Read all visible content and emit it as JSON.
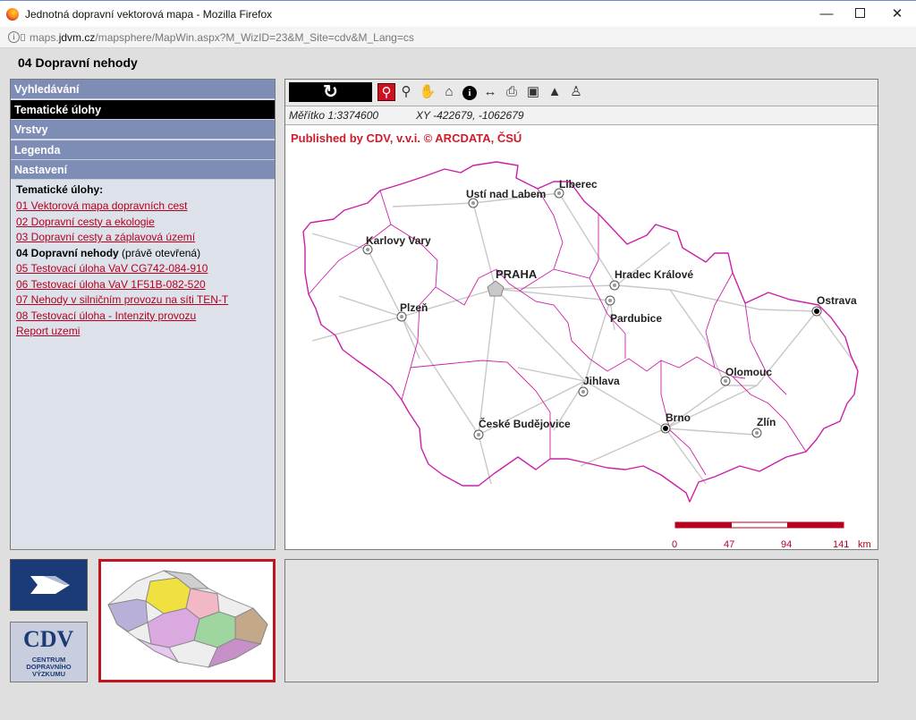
{
  "browser": {
    "window_title": "Jednotná dopravní vektorová mapa - Mozilla Firefox",
    "url_prefix": "maps.",
    "url_host": "jdvm.cz",
    "url_path": "/mapsphere/MapWin.aspx?M_WizID=23&M_Site=cdv&M_Lang=cs",
    "icons": [
      "firefox-icon",
      "info-icon",
      "lock-icon"
    ]
  },
  "page": {
    "title": "04 Dopravní nehody"
  },
  "sidebar": {
    "tabs": [
      {
        "label": "Vyhledávání",
        "active": false
      },
      {
        "label": "Tematické úlohy",
        "active": true
      },
      {
        "label": "Vrstvy",
        "active": false
      },
      {
        "label": "Legenda",
        "active": false
      },
      {
        "label": "Nastavení",
        "active": false
      }
    ],
    "heading": "Tematické úlohy:",
    "tasks": [
      {
        "label": "01 Vektorová mapa dopravních cest"
      },
      {
        "label": "02 Dopravní cesty a ekologie"
      },
      {
        "label": "03 Dopravní cesty a záplavová území"
      },
      {
        "label": "04 Dopravní nehody",
        "suffix": " (právě otevřená)"
      },
      {
        "label": "05 Testovací úloha VaV CG742-084-910"
      },
      {
        "label": "06 Testovací úloha VaV 1F51B-082-520"
      },
      {
        "label": "07 Nehody v silničním provozu na síti TEN-T"
      },
      {
        "label": "08 Testovací úloha - Intenzity provozu"
      },
      {
        "label": "Report uzemi"
      }
    ]
  },
  "map": {
    "toolbar_icons": [
      "refresh-icon",
      "zoom-in-icon",
      "zoom-out-icon",
      "pan-hand-icon",
      "home-icon",
      "info-icon",
      "measure-icon",
      "print-icon",
      "full-extent-icon",
      "stamp-icon",
      "street-view-icon"
    ],
    "scale_label": "Měřítko 1:3374600",
    "xy_label": "XY -422679, -1062679",
    "published": "Published by CDV, v.v.i.  © ARCDATA, ČSÚ",
    "cities": [
      "Ustí nad Labem",
      "Liberec",
      "Karlovy Vary",
      "PRAHA",
      "Hradec Králové",
      "Plzeň",
      "Pardubice",
      "Ostrava",
      "Olomouc",
      "Jihlava",
      "České Budějovice",
      "Brno",
      "Zlín"
    ],
    "scale_ticks": [
      "0",
      "47",
      "94",
      "141",
      "km"
    ],
    "colors": {
      "border": "#cc1fa8",
      "roads": "#bfbfbf",
      "scalebar": "#b5001e"
    }
  },
  "logos": {
    "cdv_text": "CDV",
    "cdv_sub": "CENTRUM DOPRAVNÍHO VÝZKUMU"
  }
}
